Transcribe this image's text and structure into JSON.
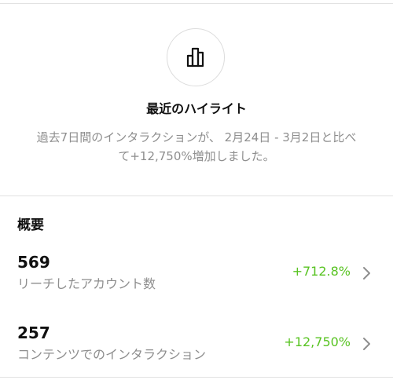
{
  "highlight": {
    "icon": "bar-chart-icon",
    "title": "最近のハイライト",
    "description": "過去7日間のインタラクションが、 2月24日 - 3月2日と比べて+12,750%増加しました。"
  },
  "overview": {
    "title": "概要",
    "metrics": [
      {
        "value": "569",
        "label": "リーチしたアカウント数",
        "change": "+712.8%"
      },
      {
        "value": "257",
        "label": "コンテンツでのインタラクション",
        "change": "+12,750%"
      }
    ]
  },
  "colors": {
    "positive": "#58c322",
    "muted": "#8e8e8e",
    "divider": "#e2e2e2"
  }
}
